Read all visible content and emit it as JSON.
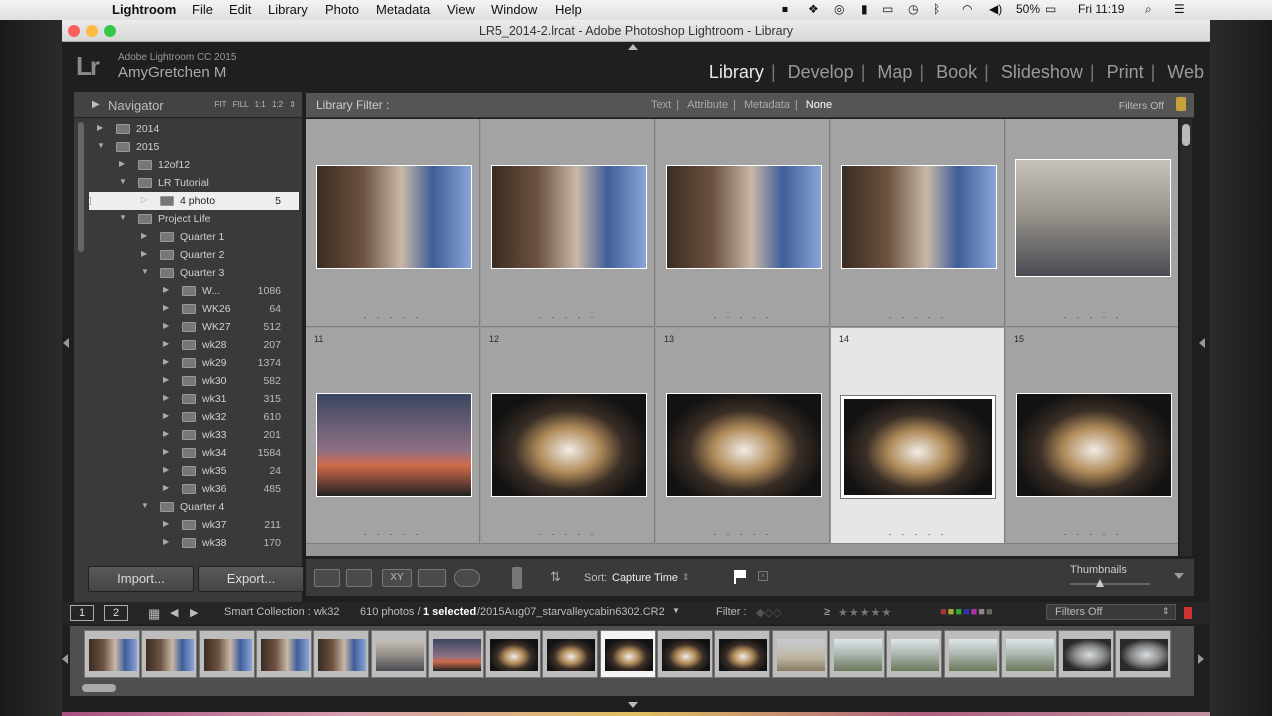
{
  "menubar": {
    "apple": "",
    "app": "Lightroom",
    "items": [
      "File",
      "Edit",
      "Library",
      "Photo",
      "Metadata",
      "View",
      "Window",
      "Help"
    ],
    "battery": "50%",
    "clock": "Fri 11:19"
  },
  "window": {
    "title": "LR5_2014-2.lrcat - Adobe Photoshop Lightroom - Library"
  },
  "identity": {
    "logo": "Lr",
    "product": "Adobe Lightroom CC 2015",
    "user": "AmyGretchen M"
  },
  "modules": [
    "Library",
    "Develop",
    "Map",
    "Book",
    "Slideshow",
    "Print",
    "Web"
  ],
  "active_module": "Library",
  "navigator": {
    "title": "Navigator",
    "options": [
      "FIT",
      "FILL",
      "1:1",
      "1:2"
    ]
  },
  "collections": [
    {
      "label": "2014",
      "count": "",
      "depth": 1,
      "arrow": "▶"
    },
    {
      "label": "2015",
      "count": "",
      "depth": 1,
      "arrow": "▼"
    },
    {
      "label": "12of12",
      "count": "",
      "depth": 2,
      "arrow": "▶"
    },
    {
      "label": "LR Tutorial",
      "count": "",
      "depth": 2,
      "arrow": "▼"
    },
    {
      "label": "4 photo",
      "count": "5",
      "depth": 3,
      "arrow": "▷",
      "selected": true
    },
    {
      "label": "Project Life",
      "count": "",
      "depth": 2,
      "arrow": "▼"
    },
    {
      "label": "Quarter 1",
      "count": "",
      "depth": 3,
      "arrow": "▶"
    },
    {
      "label": "Quarter 2",
      "count": "",
      "depth": 3,
      "arrow": "▶"
    },
    {
      "label": "Quarter 3",
      "count": "",
      "depth": 3,
      "arrow": "▼"
    },
    {
      "label": "W...",
      "count": "1086",
      "depth": 4,
      "arrow": "▶"
    },
    {
      "label": "WK26",
      "count": "64",
      "depth": 4,
      "arrow": "▶"
    },
    {
      "label": "WK27",
      "count": "512",
      "depth": 4,
      "arrow": "▶"
    },
    {
      "label": "wk28",
      "count": "207",
      "depth": 4,
      "arrow": "▶"
    },
    {
      "label": "wk29",
      "count": "1374",
      "depth": 4,
      "arrow": "▶"
    },
    {
      "label": "wk30",
      "count": "582",
      "depth": 4,
      "arrow": "▶"
    },
    {
      "label": "wk31",
      "count": "315",
      "depth": 4,
      "arrow": "▶"
    },
    {
      "label": "wk32",
      "count": "610",
      "depth": 4,
      "arrow": "▶"
    },
    {
      "label": "wk33",
      "count": "201",
      "depth": 4,
      "arrow": "▶"
    },
    {
      "label": "wk34",
      "count": "1584",
      "depth": 4,
      "arrow": "▶"
    },
    {
      "label": "wk35",
      "count": "24",
      "depth": 4,
      "arrow": "▶"
    },
    {
      "label": "wk36",
      "count": "485",
      "depth": 4,
      "arrow": "▶"
    },
    {
      "label": "Quarter 4",
      "count": "",
      "depth": 3,
      "arrow": "▼"
    },
    {
      "label": "wk37",
      "count": "211",
      "depth": 4,
      "arrow": "▶"
    },
    {
      "label": "wk38",
      "count": "170",
      "depth": 4,
      "arrow": "▶"
    }
  ],
  "panel_buttons": {
    "import": "Import...",
    "export": "Export..."
  },
  "library_filter": {
    "title": "Library Filter :",
    "tabs": [
      "Text",
      "Attribute",
      "Metadata",
      "None"
    ],
    "active": "None",
    "status": "Filters Off"
  },
  "grid": {
    "row2_numbers": [
      "11",
      "12",
      "13",
      "14",
      "15"
    ],
    "selected_cell": "14",
    "row1_images": [
      "kitchen",
      "kitchen",
      "kitchen",
      "kitchen",
      "group"
    ],
    "row2_images": [
      "sunset",
      "dog",
      "dog",
      "dog",
      "dog"
    ],
    "dots": ". . . . ."
  },
  "toolbar": {
    "sort_label": "Sort:",
    "sort_value": "Capture Time",
    "thumbnails_label": "Thumbnails",
    "thumbnail_size": 0.4
  },
  "statusbar": {
    "view1": "1",
    "view2": "2",
    "source": "Smart Collection : wk32",
    "photo_count": "610 photos /",
    "selected": "1 selected",
    "filename": "/2015Aug07_starvalleycabin6302.CR2",
    "filter_label": "Filter :",
    "filters_off": "Filters Off"
  },
  "filmstrip": {
    "images": [
      "kitchen",
      "kitchen",
      "kitchen",
      "kitchen",
      "kitchen",
      "group",
      "sunset",
      "dog",
      "dog",
      "dog",
      "dog",
      "dog",
      "road",
      "hills",
      "hills",
      "hills",
      "hills",
      "mirror",
      "mirror"
    ],
    "selected_index": 9
  },
  "colors": {
    "menubar": "#e8e8e8",
    "panel": "#3a3a3a",
    "grid": "#979797",
    "cell": "#a3a3a3",
    "selected_cell": "#e6e6e6",
    "selected_row": "#eeeeee",
    "lock": "#c9a23a"
  }
}
